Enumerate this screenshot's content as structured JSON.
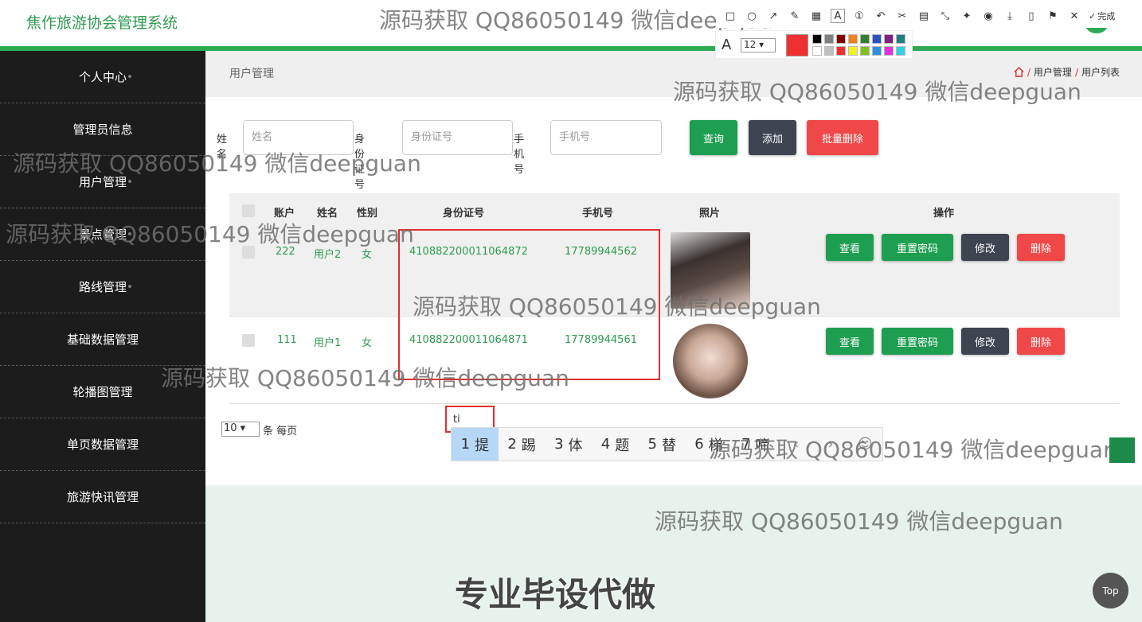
{
  "header": {
    "app_title": "焦作旅游协会管理系统"
  },
  "sidebar": {
    "items": [
      {
        "label": "个人中心"
      },
      {
        "label": "管理员信息"
      },
      {
        "label": "用户管理"
      },
      {
        "label": "景点管理"
      },
      {
        "label": "路线管理"
      },
      {
        "label": "基础数据管理"
      },
      {
        "label": "轮播图管理"
      },
      {
        "label": "单页数据管理"
      },
      {
        "label": "旅游快讯管理"
      }
    ]
  },
  "page": {
    "title": "用户管理",
    "breadcrumb": [
      "用户管理",
      "用户列表"
    ]
  },
  "search": {
    "name_label": "姓名",
    "name_placeholder": "姓名",
    "id_label": "身份证号",
    "id_placeholder": "身份证号",
    "phone_label": "手机号",
    "phone_placeholder": "手机号",
    "query_button": "查询",
    "add_button": "添加",
    "batch_delete_button": "批量删除"
  },
  "table": {
    "headers": {
      "account": "账户",
      "name": "姓名",
      "gender": "性别",
      "id_number": "身份证号",
      "phone": "手机号",
      "photo": "照片",
      "actions": "操作"
    },
    "rows": [
      {
        "account": "222",
        "name": "用户2",
        "gender": "女",
        "id_number": "410882200011064872",
        "phone": "17789944562"
      },
      {
        "account": "111",
        "name": "用户1",
        "gender": "女",
        "id_number": "410882200011064871",
        "phone": "17789944561"
      }
    ],
    "action_labels": {
      "view": "查看",
      "reset": "重置密码",
      "edit": "修改",
      "delete": "删除"
    }
  },
  "pagination": {
    "page_size": "10",
    "page_size_suffix": "条 每页",
    "ime_typed": "ti",
    "ime_candidates": [
      {
        "n": "1",
        "c": "提"
      },
      {
        "n": "2",
        "c": "踢"
      },
      {
        "n": "3",
        "c": "体"
      },
      {
        "n": "4",
        "c": "题"
      },
      {
        "n": "5",
        "c": "替"
      },
      {
        "n": "6",
        "c": "梯"
      },
      {
        "n": "7",
        "c": "啼"
      }
    ]
  },
  "screenshot_tool": {
    "font_size": "12",
    "done_label": "完成",
    "current_color": "#f03030"
  },
  "watermark_text": "源码获取 QQ86050149 微信deepguan",
  "banner_text": "专业毕设代做",
  "back_to_top": "Top",
  "colors": {
    "accent": "#2eaa55",
    "sidebar_bg": "#1c1c1c",
    "danger": "#f04848",
    "dark_button": "#3e4450"
  }
}
